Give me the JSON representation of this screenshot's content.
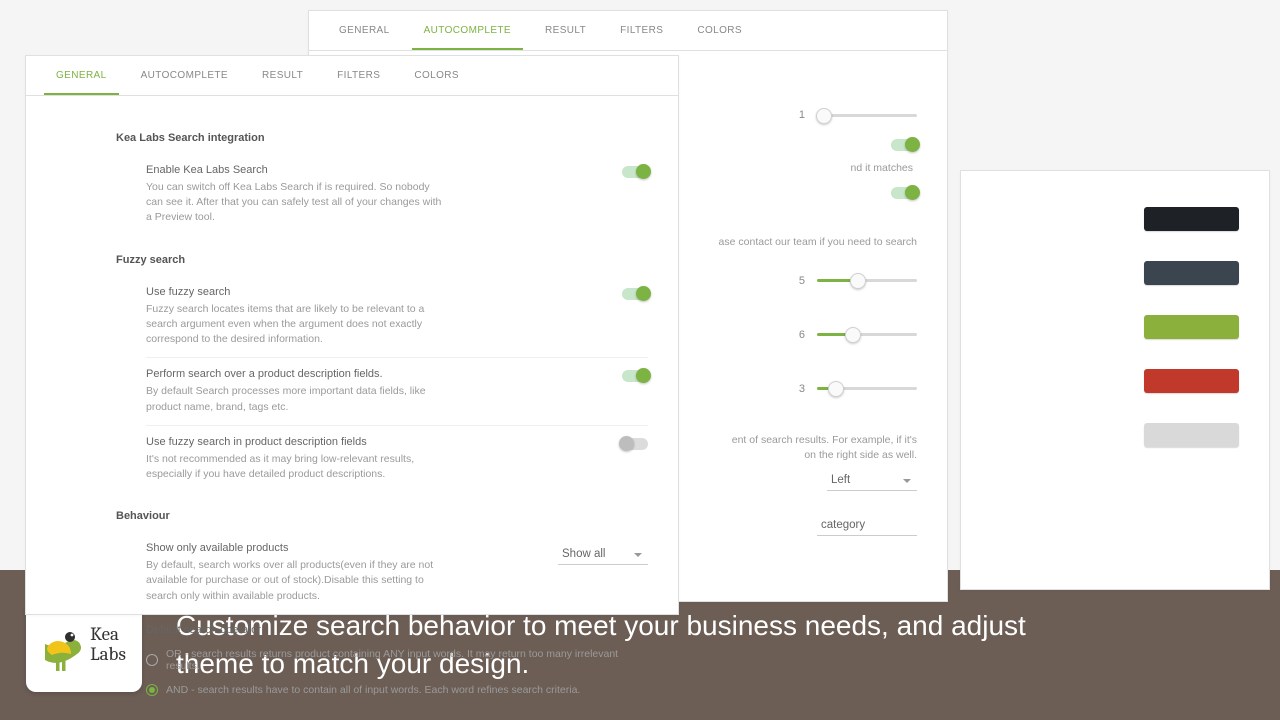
{
  "tabs": [
    "GENERAL",
    "AUTOCOMPLETE",
    "RESULT",
    "FILTERS",
    "COLORS"
  ],
  "general": {
    "sec1": "Kea Labs Search integration",
    "enable_title": "Enable Kea Labs Search",
    "enable_desc": "You can switch off Kea Labs Search if is required. So nobody can see it. After that you can safely test all of your changes with a Preview tool.",
    "sec2": "Fuzzy search",
    "fuzzy_title": "Use fuzzy search",
    "fuzzy_desc": "Fuzzy search locates items that are likely to be relevant to a search argument even when the argument does not exactly correspond to the desired information.",
    "searchdesc_title": "Perform search over a product description fields.",
    "searchdesc_desc": "By default Search processes more important data fields, like product name, brand, tags etc.",
    "fuzzydesc_title": "Use fuzzy search in product description fields",
    "fuzzydesc_desc": "It's not recommended as it may bring low-relevant results, especially if you have detailed product descriptions.",
    "sec3": "Behaviour",
    "avail_title": "Show only available products",
    "avail_desc": "By default, search works over all products(even if they are not available for purchase or out of stock).Disable this setting to search only within available products.",
    "avail_select": "Show all",
    "defop_title": "Default search operator",
    "radio_or": "OR - search results returns product containing ANY input words. It may return too many irrelevant results.",
    "radio_and": "AND - search results have to contain all of input words. Each word refines search criteria."
  },
  "autocomplete": {
    "matches_text": "nd it matches",
    "contact_text": "ase contact our team if you need to search",
    "alignment_text": "ent of search results. For example, if it's\non the right side as well.",
    "slider1": {
      "value": "1",
      "pct": "6%"
    },
    "slider5": {
      "value": "5",
      "pct": "40%"
    },
    "slider6": {
      "value": "6",
      "pct": "35%"
    },
    "slider3": {
      "value": "3",
      "pct": "18%"
    },
    "align_select": "Left",
    "category_value": "category"
  },
  "colors": [
    "#1e2126",
    "#3b4550",
    "#8bb03c",
    "#c0392b",
    "#d9d9d9"
  ],
  "footer": {
    "brand1": "Kea",
    "brand2": "Labs",
    "tagline": "Customize search behavior to meet your business needs, and adjust theme to match your design."
  }
}
